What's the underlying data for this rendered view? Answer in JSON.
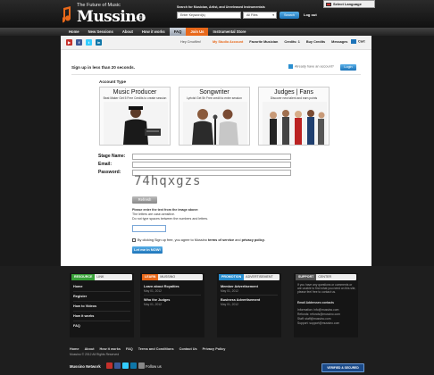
{
  "header": {
    "tagline": "The Future of Music",
    "logo": "Mussino",
    "logo_suffix": ".com",
    "search_caption": "Search for Musician, Artist, and Unreleased Instrumentals",
    "search_placeholder": "Enter Keyword(s)",
    "search_filter": "All Files",
    "search_button": "Search",
    "logout": "Log out",
    "language": "Select Language"
  },
  "nav": [
    {
      "label": "Home",
      "state": "normal"
    },
    {
      "label": "New Sessions",
      "state": "normal"
    },
    {
      "label": "About",
      "state": "normal"
    },
    {
      "label": "How it works",
      "state": "normal"
    },
    {
      "label": "FAQ",
      "state": "active"
    },
    {
      "label": "Join Us",
      "state": "hot"
    },
    {
      "label": "Instrumental Store",
      "state": "normal"
    }
  ],
  "subbar": {
    "greeting": "Hey Cmoflim!",
    "links": [
      {
        "label": "My Studio Account",
        "active": true
      },
      {
        "label": "Favorite Musician",
        "active": false
      },
      {
        "label": "Credits: 1",
        "active": false
      },
      {
        "label": "Buy Credits",
        "active": false
      },
      {
        "label": "Messages",
        "active": false
      }
    ],
    "cart": "Cart"
  },
  "signup": {
    "heading": "Sign up in less than 20 seconds.",
    "already": "Already have an account?",
    "login": "Login",
    "account_type_label": "Account Type",
    "cards": [
      {
        "title": "Music Producer",
        "subtitle": "Beat Maker Get 5 Free Credits to create session"
      },
      {
        "title": "Songwriter",
        "subtitle": "Lyricist Get 5h Free credit to enter session"
      },
      {
        "title": "Judges | Fans",
        "subtitle": "Discover new talent and earn points"
      }
    ],
    "fields": {
      "stage_name": "Stage Name:",
      "email": "Email:",
      "password": "Password:"
    },
    "captcha_text": "74hqxgzs",
    "refresh": "Refresh",
    "captcha_note_1": "Please enter the text from the image above:",
    "captcha_note_2": "The letters are case-sensitive.",
    "captcha_note_3": "Do not type spaces between the numbers and letters.",
    "agree_prefix": "By clicking Sign up free, you agree to Mussino",
    "agree_terms": "terms of service",
    "agree_and": "and",
    "agree_privacy": "privacy policy.",
    "submit": "Let me in NOW!"
  },
  "footer": {
    "resource": {
      "tag": "RESOURCE",
      "label": "LINK",
      "color": "#3aa23a",
      "links": [
        "Home",
        "Register",
        "How to Videos",
        "How it works",
        "FAQ"
      ]
    },
    "learn": {
      "tag": "LEARN",
      "label": "MUSSINO",
      "color": "#e8681a",
      "items": [
        {
          "title": "Learn about Royalties",
          "date": "May 01, 2012"
        },
        {
          "title": "Who the Judges",
          "date": "May 01, 2012"
        }
      ]
    },
    "promotion": {
      "tag": "PROMOTION",
      "label": "ADVERTISEMENT",
      "color": "#2a8fd0",
      "items": [
        {
          "title": "Member Advertisement",
          "date": "May 01, 2012"
        },
        {
          "title": "Business Advertisement",
          "date": "May 01, 2012"
        }
      ]
    },
    "support": {
      "tag": "SUPPORT",
      "label": "CENTER",
      "color": "#555555",
      "text": "If you have any questions or comments or are unable to find what you need on this site, please feel free to contact us.",
      "contacts_title": "Email Addresses contacts",
      "contacts": [
        "Information: info@mussino.com",
        "Refunds: refunds@mussino.com",
        "Staff: staff@mussino.com",
        "Support: support@mussino.com"
      ]
    }
  },
  "bottom": {
    "links": [
      "Home",
      "About",
      "How it works",
      "FAQ",
      "Terms and Conditions",
      "Contact Us",
      "Privacy Policy"
    ],
    "copyright": "Mussino © 2012 All Rights Reserved",
    "network": "Mussino Network",
    "follow": "Follow us",
    "secured": "VERIFIED & SECURED"
  }
}
